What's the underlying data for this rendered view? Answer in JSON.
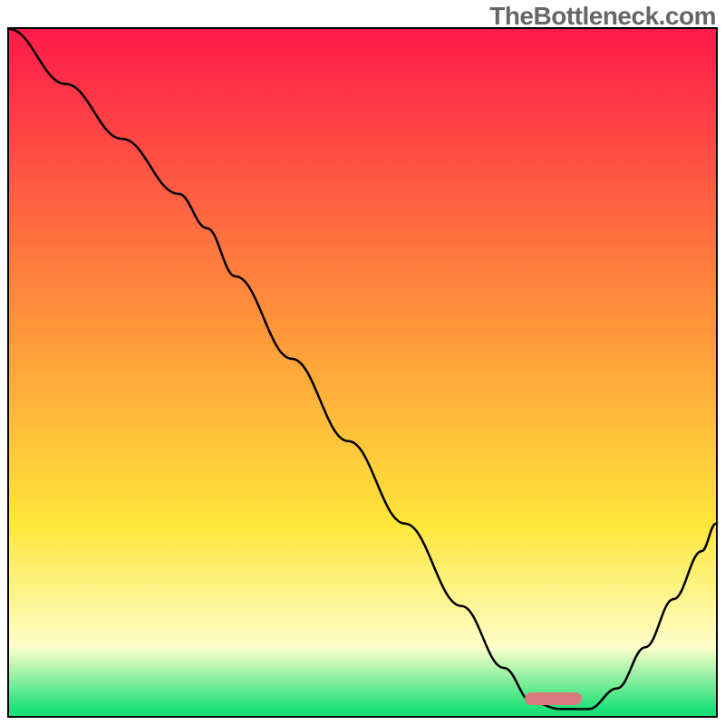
{
  "watermark": "TheBottleneck.com",
  "colors": {
    "gradient_top": "#ff1a4a",
    "gradient_mid_orange": "#ff9a3a",
    "gradient_mid_yellow": "#ffe63a",
    "gradient_pale": "#fdffc9",
    "gradient_green": "#1de079",
    "curve": "#000000",
    "marker": "#d97b7e",
    "frame": "#000000"
  },
  "marker": {
    "x_frac": 0.77,
    "y_frac": 0.975,
    "w_frac": 0.08,
    "h_frac": 0.018
  },
  "chart_data": {
    "type": "line",
    "title": "",
    "xlabel": "",
    "ylabel": "",
    "xlim": [
      0,
      100
    ],
    "ylim": [
      0,
      100
    ],
    "grid": false,
    "legend": false,
    "series": [
      {
        "name": "bottleneck-curve",
        "x": [
          0,
          8,
          16,
          24,
          28,
          32,
          40,
          48,
          56,
          64,
          70,
          74,
          78,
          82,
          86,
          90,
          94,
          98,
          100
        ],
        "y": [
          100,
          92,
          84,
          76,
          71,
          64,
          52,
          40,
          28,
          16,
          7,
          2,
          1,
          1,
          4,
          10,
          17,
          24,
          28
        ]
      }
    ],
    "annotations": [
      {
        "type": "marker-rect",
        "x_center": 80,
        "y_center": 2,
        "width": 8,
        "height": 2,
        "color": "#d97b7e"
      }
    ],
    "background_gradient_stops": [
      {
        "pos": 0.0,
        "color": "#ff1a4a"
      },
      {
        "pos": 0.45,
        "color": "#ff9a3a"
      },
      {
        "pos": 0.72,
        "color": "#ffe63a"
      },
      {
        "pos": 0.9,
        "color": "#fdffc9"
      },
      {
        "pos": 0.99,
        "color": "#1de079"
      },
      {
        "pos": 1.0,
        "color": "#1de079"
      }
    ]
  }
}
